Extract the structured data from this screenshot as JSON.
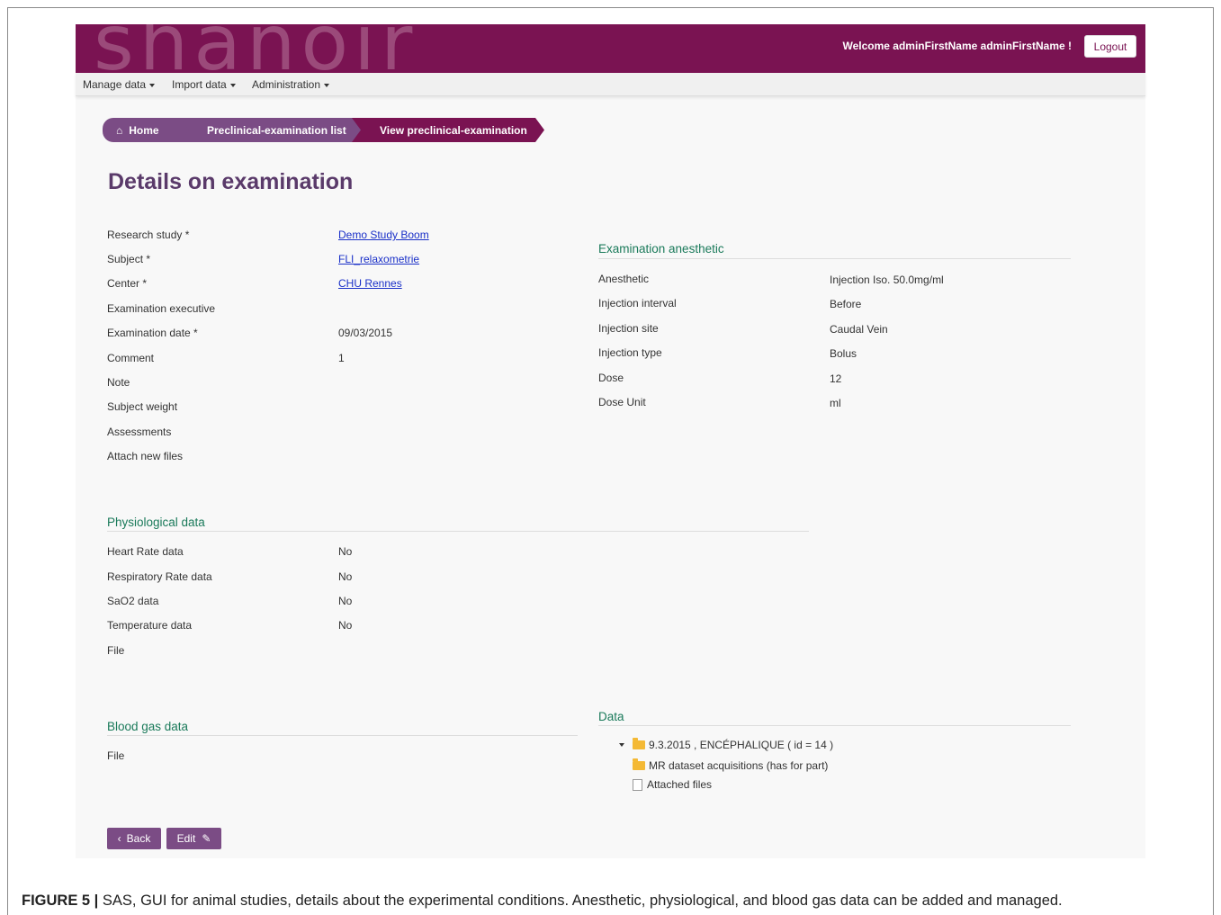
{
  "header": {
    "logo": "shanoir",
    "welcome": "Welcome adminFirstName adminFirstName !",
    "logout_label": "Logout"
  },
  "menu": {
    "items": [
      "Manage data",
      "Import data",
      "Administration"
    ]
  },
  "breadcrumb": {
    "home": "Home",
    "list": "Preclinical-examination list",
    "current": "View preclinical-examination"
  },
  "page_title": "Details on examination",
  "details": [
    {
      "label": "Research study *",
      "value": "Demo Study Boom",
      "link": true
    },
    {
      "label": "Subject *",
      "value": "FLI_relaxometrie",
      "link": true
    },
    {
      "label": "Center *",
      "value": "CHU Rennes",
      "link": true
    },
    {
      "label": "Examination executive",
      "value": ""
    },
    {
      "label": "Examination date *",
      "value": "09/03/2015"
    },
    {
      "label": "Comment",
      "value": "1"
    },
    {
      "label": "Note",
      "value": ""
    },
    {
      "label": "Subject weight",
      "value": ""
    },
    {
      "label": "Assessments",
      "value": ""
    },
    {
      "label": "Attach new files",
      "value": ""
    }
  ],
  "anesthetic": {
    "title": "Examination anesthetic",
    "rows": [
      {
        "label": "Anesthetic",
        "value": "Injection Iso. 50.0mg/ml"
      },
      {
        "label": "Injection interval",
        "value": "Before"
      },
      {
        "label": "Injection site",
        "value": "Caudal Vein"
      },
      {
        "label": "Injection type",
        "value": "Bolus"
      },
      {
        "label": "Dose",
        "value": "12"
      },
      {
        "label": "Dose Unit",
        "value": "ml"
      }
    ]
  },
  "physiological": {
    "title": "Physiological data",
    "rows": [
      {
        "label": "Heart Rate data",
        "value": "No"
      },
      {
        "label": "Respiratory Rate data",
        "value": "No"
      },
      {
        "label": "SaO2 data",
        "value": "No"
      },
      {
        "label": "Temperature data",
        "value": "No"
      },
      {
        "label": "File",
        "value": ""
      }
    ]
  },
  "blood_gas": {
    "title": "Blood gas data",
    "rows": [
      {
        "label": "File",
        "value": ""
      }
    ]
  },
  "data_tree": {
    "title": "Data",
    "root": "9.3.2015 , ENCÉPHALIQUE ( id = 14 )",
    "children": [
      "MR dataset acquisitions (has for part)",
      "Attached files"
    ]
  },
  "buttons": {
    "back": "Back",
    "edit": "Edit"
  },
  "caption": {
    "label": "FIGURE 5 |",
    "text": " SAS, GUI for animal studies, details about the experimental conditions. Anesthetic, physiological, and blood gas data can be added and managed."
  },
  "colors": {
    "banner": "#7a1352",
    "breadcrumb": "#7b4c85",
    "section_title": "#1a7a5a",
    "link": "#1a30c8"
  }
}
